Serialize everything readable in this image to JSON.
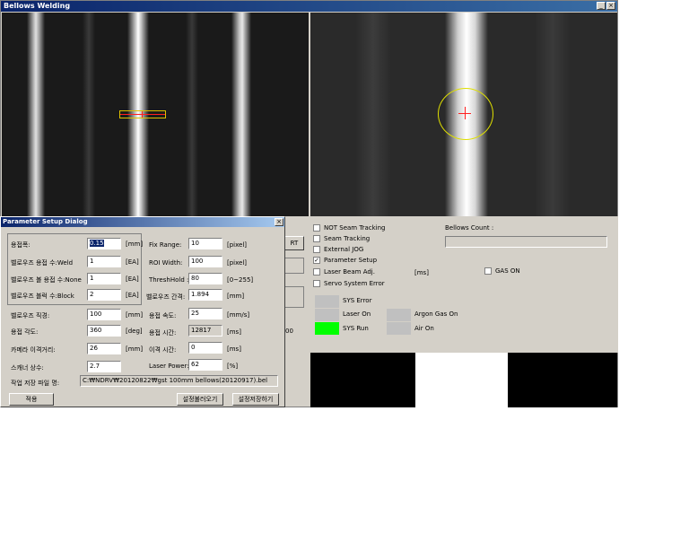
{
  "window": {
    "title": "Bellows Welding",
    "minimize_label": "_",
    "maximize_label": "□",
    "close_label": "×"
  },
  "right_panel": {
    "checkboxes": [
      {
        "label": "NOT Seam Tracking",
        "checked": false
      },
      {
        "label": "Seam Tracking",
        "checked": false
      },
      {
        "label": "External JOG",
        "checked": false
      },
      {
        "label": "Parameter Setup",
        "checked": true
      },
      {
        "label": "Laser Beam Adj.",
        "checked": false
      },
      {
        "label": "Servo System Error",
        "checked": false
      }
    ],
    "gas_on_label": "GAS ON",
    "ms_label": "[ms]",
    "bellows_count_label": "Bellows Count :",
    "bellows_count_value": "",
    "lamps": {
      "sys_error": "SYS Error",
      "laser_on": "Laser On",
      "sys_run": "SYS Run",
      "argon_gas_on": "Argon Gas On",
      "air_on": "Air On"
    },
    "colors": {
      "sys_run_lamp": "#00ff00",
      "lamp_off": "#c0c0c0"
    }
  },
  "partial": {
    "start_button_fragment": "RT",
    "value_fragment": "00"
  },
  "dialog": {
    "title": "Parameter Setup Dialog",
    "close_label": "×",
    "left_fields": [
      {
        "label": "용접폭:",
        "value": "0.15",
        "unit": "[mm]"
      },
      {
        "label": "벨로우즈 용접 수:Weld",
        "value": "1",
        "unit": "[EA]"
      },
      {
        "label": "벨로우즈 볼 용접 수:None",
        "value": "1",
        "unit": "[EA]"
      },
      {
        "label": "벨로우즈 블럭 수:Block",
        "value": "2",
        "unit": "[EA]"
      },
      {
        "label": "벨로우즈 직경:",
        "value": "100",
        "unit": "[mm]"
      },
      {
        "label": "용접 각도:",
        "value": "360",
        "unit": "[deg]"
      },
      {
        "label": "카메라 이격거리:",
        "value": "26",
        "unit": "[mm]"
      },
      {
        "label": "스캐너 상수:",
        "value": "2.7",
        "unit": ""
      }
    ],
    "right_fields": [
      {
        "label": "Fix Range:",
        "value": "10",
        "unit": "[pixel]"
      },
      {
        "label": "ROI Width:",
        "value": "100",
        "unit": "[pixel]"
      },
      {
        "label": "ThreshHold :",
        "value": "80",
        "unit": "[0~255]"
      },
      {
        "label": "벨로우즈 간격:",
        "value": "1.894",
        "unit": "[mm]"
      },
      {
        "label": "용접 속도:",
        "value": "25",
        "unit": "[mm/s]"
      },
      {
        "label": "용접 시간:",
        "value": "12817",
        "unit": "[ms]"
      },
      {
        "label": "이격 시간:",
        "value": "0",
        "unit": "[ms]"
      },
      {
        "label": "Laser Power:",
        "value": "62",
        "unit": "[%]"
      }
    ],
    "file_label": "작업 저장 파일 명:",
    "file_value": "C:₩NDRV₩20120822₩gst 100mm bellows(20120917).bel",
    "apply_button": "적용",
    "load_button": "설정불러오기",
    "save_button": "설정저장하기"
  }
}
